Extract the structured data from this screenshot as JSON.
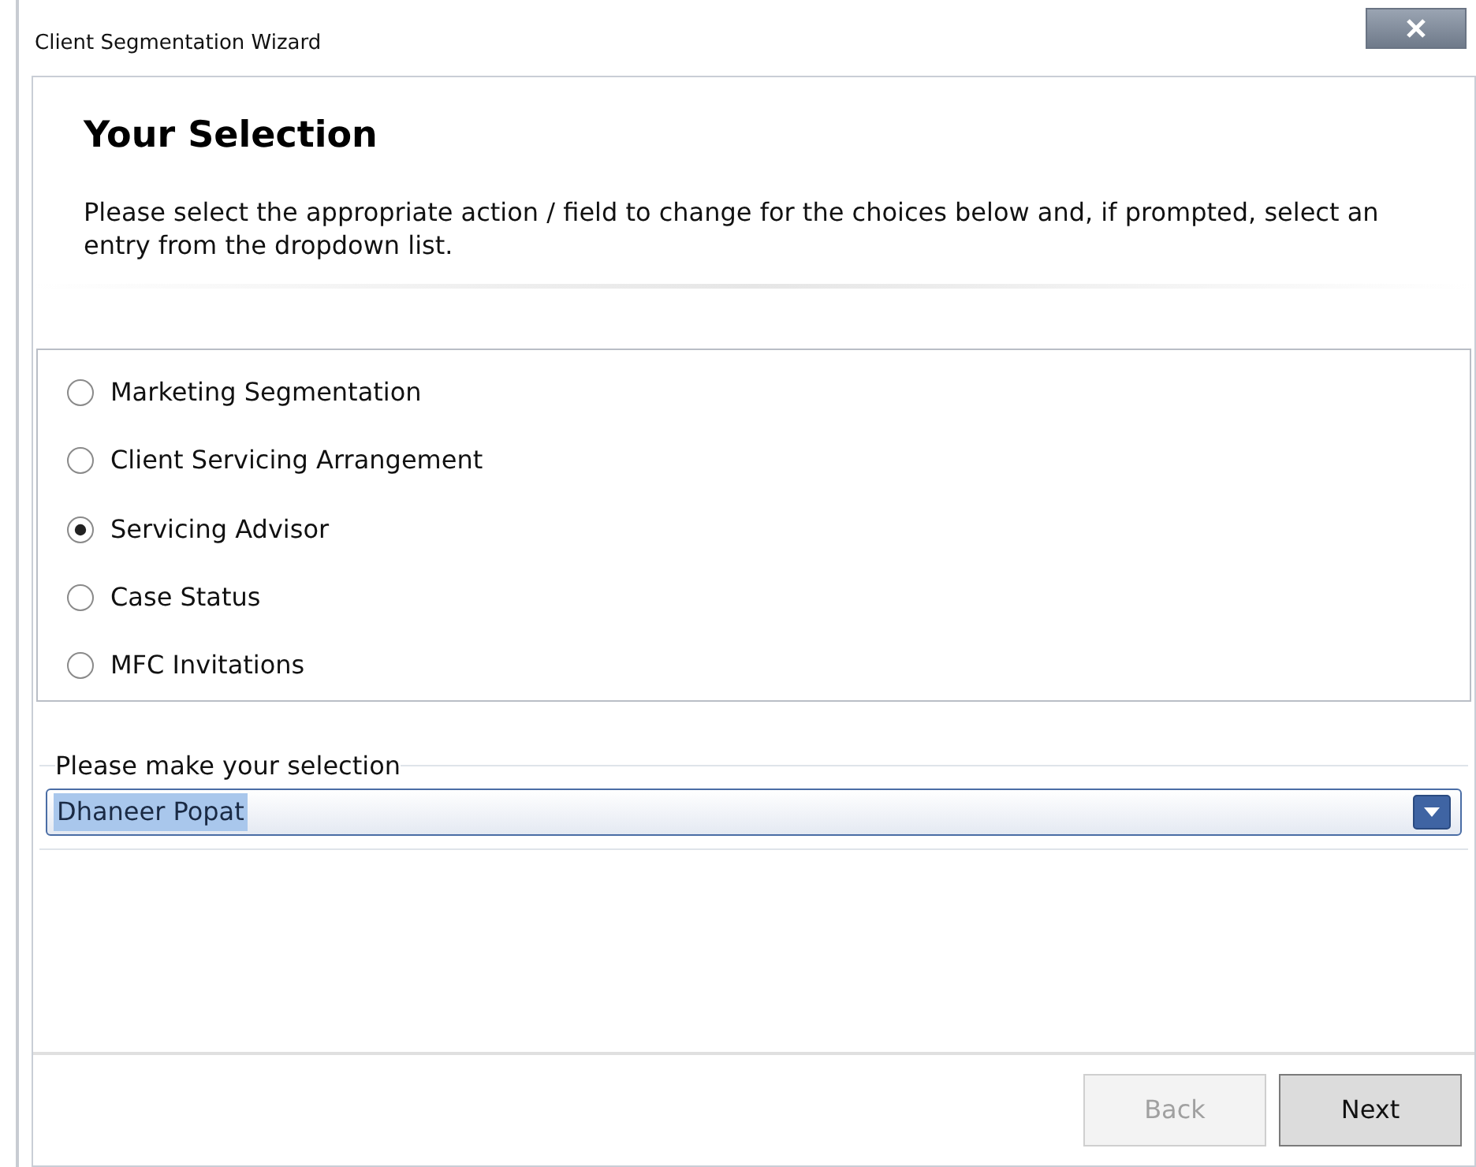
{
  "window": {
    "title": "Client Segmentation Wizard"
  },
  "header": {
    "title": "Your Selection",
    "instructions": "Please select the appropriate action / field to change for the choices below and, if prompted, select an entry from the dropdown list."
  },
  "options": [
    {
      "label": "Marketing Segmentation",
      "selected": false
    },
    {
      "label": "Client Servicing Arrangement",
      "selected": false
    },
    {
      "label": "Servicing Advisor",
      "selected": true
    },
    {
      "label": "Case Status",
      "selected": false
    },
    {
      "label": "MFC Invitations",
      "selected": false
    }
  ],
  "selection": {
    "label": "Please make your selection",
    "value": "Dhaneer Popat",
    "highlighted": true
  },
  "buttons": [
    {
      "label": "Back",
      "disabled": true
    },
    {
      "label": "Next",
      "disabled": false
    }
  ]
}
